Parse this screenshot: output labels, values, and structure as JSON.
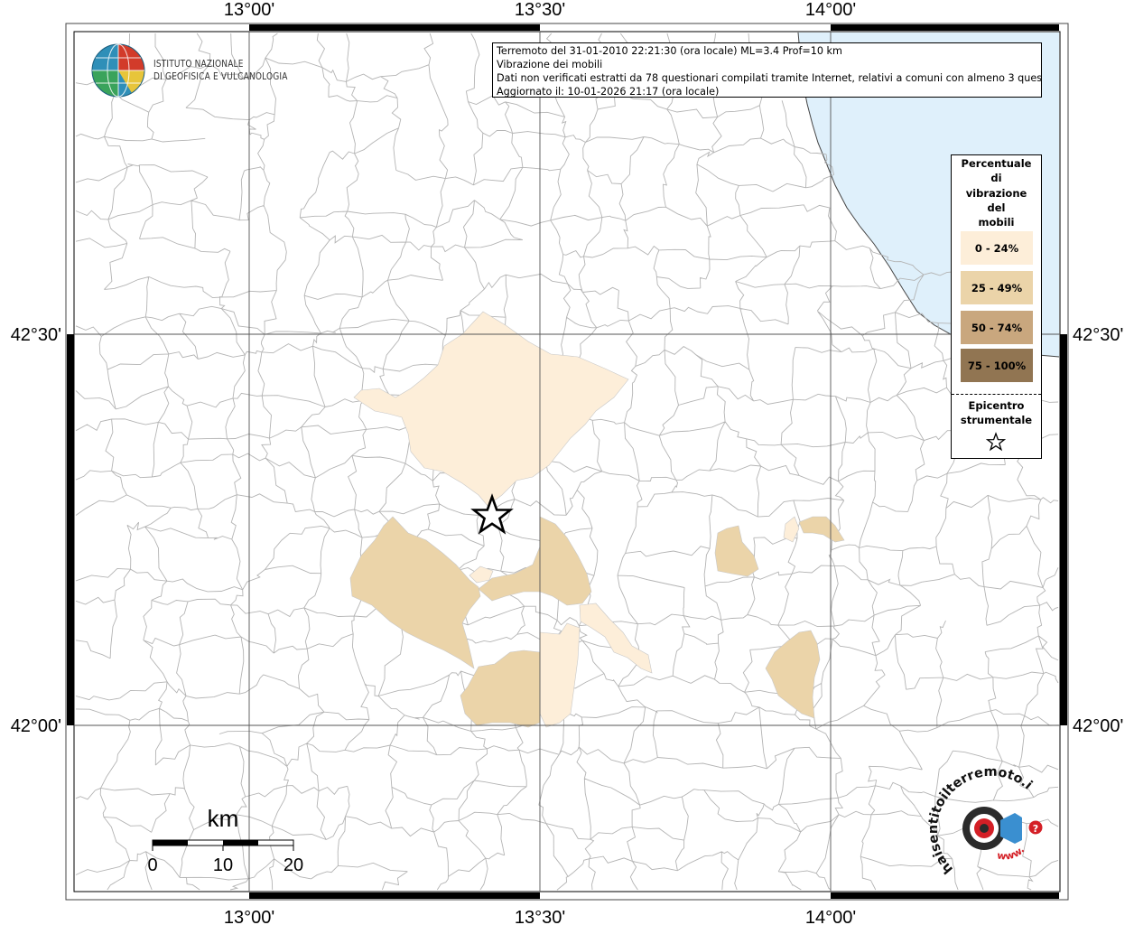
{
  "info": {
    "line1": "Terremoto del 31-01-2010 22:21:30 (ora locale) ML=3.4 Prof=10 km",
    "line2": "Vibrazione dei mobili",
    "line3": "Dati non verificati estratti da 78 questionari compilati tramite Internet, relativi a comuni con almeno 3 questionari.",
    "line4": "Aggiornato il: 10-01-2026 21:17 (ora locale)"
  },
  "logo": {
    "line1": "ISTITUTO NAZIONALE",
    "line2": "DI GEOFISICA E VULCANOLOGIA"
  },
  "axes": {
    "lon_top": [
      "13°00'",
      "13°30'",
      "14°00'"
    ],
    "lon_bottom": [
      "13°00'",
      "13°30'",
      "14°00'"
    ],
    "lat_left": [
      "42°30'",
      "42°00'"
    ],
    "lat_right": [
      "42°30'",
      "42°00'"
    ]
  },
  "legend": {
    "title_lines": [
      "Percentuale",
      "di",
      "vibrazione",
      "del",
      "mobili"
    ],
    "classes": [
      {
        "label": "0 - 24%",
        "color": "#fdeed9"
      },
      {
        "label": "25 - 49%",
        "color": "#ebd4a9"
      },
      {
        "label": "50 - 74%",
        "color": "#c9a77e"
      },
      {
        "label": "75 - 100%",
        "color": "#917552"
      }
    ],
    "epicenter_lines": [
      "Epicentro",
      "strumentale"
    ]
  },
  "scalebar": {
    "unit": "km",
    "ticks": [
      "0",
      "10",
      "20"
    ]
  },
  "brand": {
    "text": "haisentitoilterremoto.it",
    "www": "www.",
    "question": "?"
  },
  "colors": {
    "sea": "#dff0fb",
    "boundaries": "#b4b4b4",
    "grid": "#000000"
  }
}
